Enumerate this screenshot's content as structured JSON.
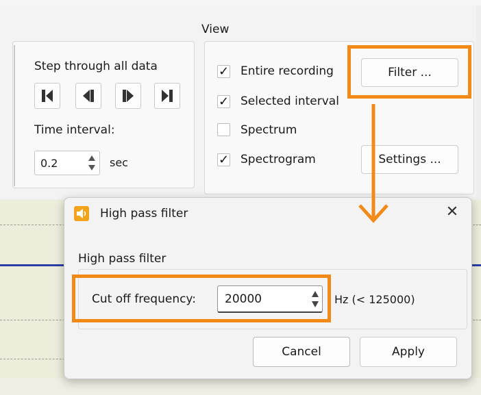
{
  "ribbon": {
    "view_label": "View",
    "step_label": "Step through all data",
    "nav_buttons": [
      "first-icon",
      "previous-icon",
      "next-icon",
      "last-icon"
    ],
    "time_interval_label": "Time interval:",
    "time_interval_value": "0.2",
    "time_unit": "sec",
    "view_options": [
      {
        "label": "Entire recording",
        "checked": true
      },
      {
        "label": "Selected interval",
        "checked": true
      },
      {
        "label": "Spectrum",
        "checked": false
      },
      {
        "label": "Spectrogram",
        "checked": true
      }
    ],
    "filter_button": "Filter ...",
    "settings_button": "Settings ..."
  },
  "dialog": {
    "title": "High pass filter",
    "icon": "speaker-icon",
    "group_title": "High pass filter",
    "cutoff_label": "Cut off frequency:",
    "cutoff_value": "20000",
    "unit_hint": "Hz (< 125000)",
    "cancel_label": "Cancel",
    "apply_label": "Apply"
  },
  "colors": {
    "highlight": "#f28a1a",
    "signal": "#2b3ea8",
    "dialog_icon": "#f4a41c"
  }
}
